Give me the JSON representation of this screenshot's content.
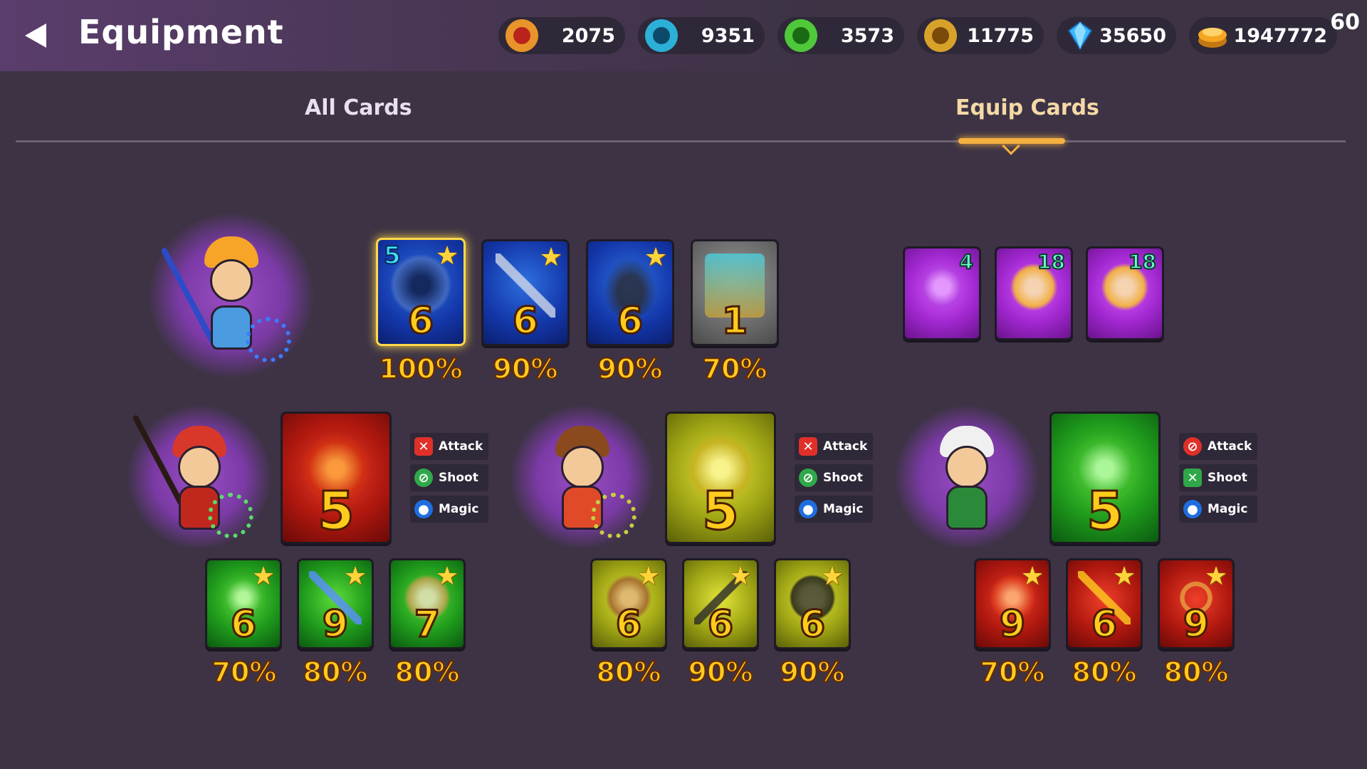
{
  "header": {
    "title": "Equipment",
    "back_icon": "back-arrow-icon",
    "fps": "60"
  },
  "currencies": [
    {
      "icon": "red-gem-coin-icon",
      "color": "#e8942a",
      "value": "2075"
    },
    {
      "icon": "blue-gem-coin-icon",
      "color": "#2bb0d8",
      "value": "9351"
    },
    {
      "icon": "green-gem-coin-icon",
      "color": "#4fc83a",
      "value": "3573"
    },
    {
      "icon": "gold-gem-coin-icon",
      "color": "#d8a22a",
      "value": "11775"
    },
    {
      "icon": "diamond-icon",
      "color": "#3ab8ff",
      "value": "35650"
    },
    {
      "icon": "gold-coins-icon",
      "color": "#f5a623",
      "value": "1947772"
    }
  ],
  "tabs": [
    {
      "label": "All Cards",
      "active": false
    },
    {
      "label": "Equip Cards",
      "active": true
    }
  ],
  "main_hero": {
    "name": "hero-portrait-blue-knight",
    "cards": [
      {
        "corner": "5",
        "level": "6",
        "percent": "100%",
        "bg": "blue",
        "icon": "vortex-shield-icon",
        "selected": true
      },
      {
        "level": "6",
        "percent": "90%",
        "bg": "blue",
        "icon": "sword-icon"
      },
      {
        "level": "6",
        "percent": "90%",
        "bg": "blue",
        "icon": "boots-icon"
      },
      {
        "level": "1",
        "percent": "70%",
        "bg": "grey",
        "icon": "treasure-chest-icon"
      }
    ],
    "consumables": [
      {
        "count": "4",
        "icon": "potion-icon"
      },
      {
        "count": "18",
        "icon": "helmet-icon"
      },
      {
        "count": "18",
        "icon": "hexagon-gem-icon"
      }
    ]
  },
  "tag_labels": {
    "attack": "Attack",
    "shoot": "Shoot",
    "magic": "Magic"
  },
  "companions": [
    {
      "name": "companion-spear-warrior",
      "card": {
        "level": "5",
        "bg": "red"
      },
      "items": [
        {
          "level": "6",
          "percent": "70%",
          "bg": "green",
          "icon": "green-orb-icon"
        },
        {
          "level": "9",
          "percent": "80%",
          "bg": "green",
          "icon": "green-sword-icon"
        },
        {
          "level": "7",
          "percent": "80%",
          "bg": "green",
          "icon": "green-shield-icon"
        }
      ]
    },
    {
      "name": "companion-axe-girl",
      "card": {
        "level": "5",
        "bg": "yellow"
      },
      "items": [
        {
          "level": "6",
          "percent": "80%",
          "bg": "yellow",
          "icon": "helmet-icon"
        },
        {
          "level": "6",
          "percent": "90%",
          "bg": "yellow",
          "icon": "double-axe-icon"
        },
        {
          "level": "6",
          "percent": "90%",
          "bg": "yellow",
          "icon": "armor-icon"
        }
      ]
    },
    {
      "name": "companion-masked-ninja",
      "card": {
        "level": "5",
        "bg": "green"
      },
      "items": [
        {
          "level": "9",
          "percent": "70%",
          "bg": "red",
          "icon": "fire-orb-icon"
        },
        {
          "level": "6",
          "percent": "80%",
          "bg": "red",
          "icon": "golden-staff-icon"
        },
        {
          "level": "9",
          "percent": "80%",
          "bg": "red",
          "icon": "ring-icon"
        }
      ]
    }
  ]
}
